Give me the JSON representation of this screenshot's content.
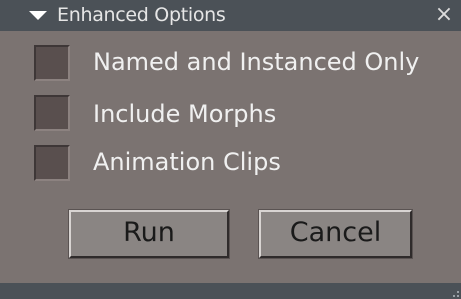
{
  "window": {
    "title": "Enhanced Options",
    "close_glyph": "×"
  },
  "options": [
    {
      "label": "Named and Instanced Only",
      "checked": false
    },
    {
      "label": "Include Morphs",
      "checked": false
    },
    {
      "label": "Animation Clips",
      "checked": false
    }
  ],
  "buttons": {
    "run_label": "Run",
    "cancel_label": "Cancel"
  },
  "icons": {
    "collapse": "triangle-down",
    "close": "x-mark",
    "resize": "resize-grip"
  },
  "colors": {
    "titlebar": "#4b5157",
    "panel": "#7b7371",
    "checkbox": "#594f4e",
    "button": "#8a8583"
  }
}
